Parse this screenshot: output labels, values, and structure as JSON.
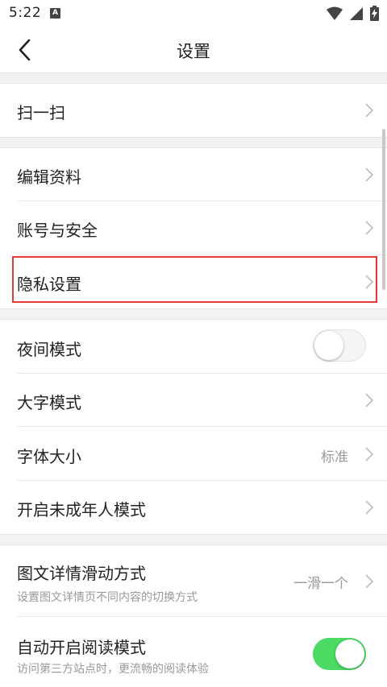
{
  "status": {
    "time": "5:22",
    "notif": "A"
  },
  "nav": {
    "title": "设置"
  },
  "rows": {
    "scan": {
      "label": "扫一扫"
    },
    "edit_profile": {
      "label": "编辑资料"
    },
    "account": {
      "label": "账号与安全"
    },
    "privacy": {
      "label": "隐私设置"
    },
    "night": {
      "label": "夜间模式",
      "on": false
    },
    "large_text": {
      "label": "大字模式"
    },
    "font_size": {
      "label": "字体大小",
      "value": "标准"
    },
    "minor": {
      "label": "开启未成年人模式"
    },
    "slide": {
      "label": "图文详情滑动方式",
      "sub": "设置图文详情页不同内容的切换方式",
      "value": "一滑一个"
    },
    "reader": {
      "label": "自动开启阅读模式",
      "sub": "访问第三方站点时，更流畅的阅读体验",
      "on": true
    }
  },
  "colors": {
    "toggle_on": "#4cd964",
    "highlight": "#e53935"
  }
}
